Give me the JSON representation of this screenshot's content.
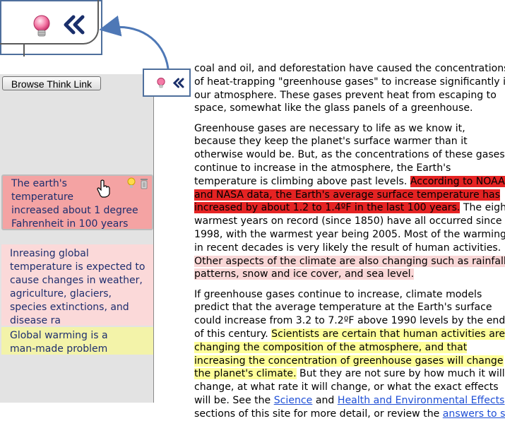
{
  "callout": {
    "bulb_icon": "lightbulb-icon",
    "collapse_icon": "double-chevron-left-icon",
    "accent": "#4e6f9c"
  },
  "panel": {
    "browse_label": "Browse Think Link",
    "notes": [
      {
        "lines": [
          "The earth's",
          "temperature",
          "increased about 1 degree",
          "Fahrenheit in 100 years"
        ],
        "color": "#f4a3a3"
      },
      {
        "lines": [
          "Inreasing global",
          "temperature is expected to",
          "cause changes in weather,",
          "agriculture, glaciers,",
          "species extinctions, and",
          "disease ra"
        ],
        "color": "#fbd9d9"
      },
      {
        "lines": [
          "Global warming is a",
          "man-made problem"
        ],
        "color": "#f3f3a9"
      }
    ]
  },
  "article": {
    "p1": [
      "coal and oil, and deforestation have caused the concentrations",
      "of heat-trapping \"greenhouse gases\" to increase significantly in",
      "our atmosphere. These gases prevent heat from escaping to",
      "space, somewhat like the glass panels of a greenhouse."
    ],
    "p2": {
      "l1": "Greenhouse gases are necessary to life as we know it,",
      "l2": "because they keep the planet's surface warmer than it",
      "l3": "otherwise would be. But, as the concentrations of these gases",
      "l4": "continue to increase in the atmosphere, the Earth's",
      "l5a": "temperature is climbing above past levels. ",
      "l5b": "According to NOAA",
      "l6": "and NASA data, the Earth's average surface temperature has",
      "l7": "increased by about 1.2 to 1.4ºF in the last 100 years.",
      "l7b": " The eight",
      "l8": "warmest years on record (since 1850) have all occurred since",
      "l9": "1998, with the warmest year being 2005. Most of the warming",
      "l10": "in recent decades is very likely the result of human activities.",
      "l11": "Other aspects of the climate are also changing such as rainfall",
      "l12": "patterns, snow and ice cover, and sea level."
    },
    "p3": {
      "l1": "If greenhouse gases continue to increase, climate models",
      "l2": "predict that the average temperature at the Earth's surface",
      "l3": "could increase from 3.2 to 7.2ºF above 1990 levels by the end",
      "l4a": "of this century. ",
      "l4b": "Scientists are certain that human activities are",
      "l5": "changing the composition of the atmosphere, and that",
      "l6": "increasing the concentration of greenhouse gases will change",
      "l7a": "the planet's climate.",
      "l7b": " But they are not sure by how much it will",
      "l8": "change, at what rate it will change, or what the exact effects",
      "l9a": "will be. See the ",
      "l9link1": "Science",
      "l9b": " and ",
      "l9link2": "Health and Environmental Effects",
      "l10a": "sections of this site for more detail, or review the ",
      "l10link": "answers to sor"
    },
    "colors": {
      "highlight_red": "#e52323",
      "highlight_pink": "#f9d6d6",
      "highlight_yellow": "#ffff99",
      "link": "#1f4fd6"
    }
  }
}
